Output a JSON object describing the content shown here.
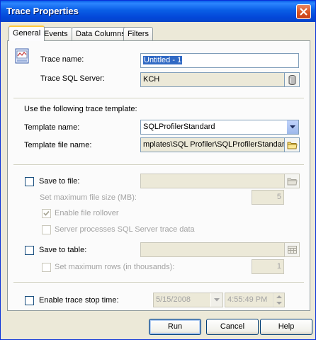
{
  "window": {
    "title": "Trace Properties"
  },
  "tabs": [
    {
      "label": "General"
    },
    {
      "label": "Events"
    },
    {
      "label": "Data Columns"
    },
    {
      "label": "Filters"
    }
  ],
  "general": {
    "trace_name_label": "Trace name:",
    "trace_name_value": "Untitled - 1",
    "trace_server_label": "Trace SQL Server:",
    "trace_server_value": "KCH",
    "template_heading": "Use the following trace template:",
    "template_name_label": "Template name:",
    "template_name_value": "SQLProfilerStandard",
    "template_file_label": "Template file name:",
    "template_file_value": "mplates\\SQL Profiler\\SQLProfilerStandard.tdf",
    "save_to_file_label": "Save to file:",
    "max_file_size_label": "Set maximum file size (MB):",
    "max_file_size_value": "5",
    "file_rollover_label": "Enable file rollover",
    "server_processes_label": "Server processes SQL Server trace data",
    "save_to_table_label": "Save to table:",
    "max_rows_label": "Set maximum rows (in thousands):",
    "max_rows_value": "1",
    "stop_time_label": "Enable trace stop time:",
    "stop_date_value": "5/15/2008",
    "stop_time_value": "4:55:49 PM"
  },
  "buttons": {
    "run": "Run",
    "cancel": "Cancel",
    "help": "Help"
  },
  "icons": {
    "close": "close-icon",
    "trace": "trace-properties-icon",
    "server": "server-cylinder-icon",
    "folder": "folder-icon",
    "table": "table-icon",
    "dropdown": "chevron-down-icon",
    "checkmark": "checkmark-icon"
  },
  "colors": {
    "title_bar": "#0a5ee6",
    "selection": "#316ac5",
    "close_button": "#d9531f"
  }
}
